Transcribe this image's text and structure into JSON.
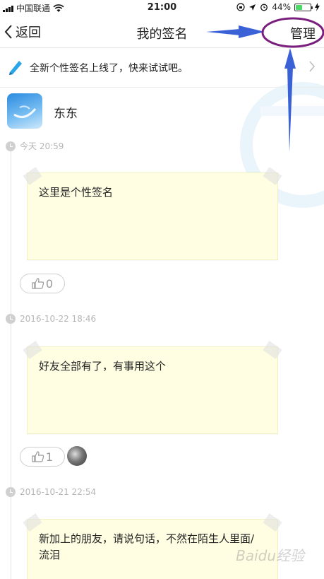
{
  "status_bar": {
    "carrier": "中国联通",
    "time": "21:00",
    "battery": "44%",
    "battery_level": 0.44
  },
  "nav": {
    "back_label": "返回",
    "title": "我的签名",
    "manage_label": "管理"
  },
  "banner": {
    "text": "全新个性签名上线了，快来试试吧。"
  },
  "profile": {
    "name": "东东"
  },
  "entries": [
    {
      "time": "今天 20:59",
      "text": "这里是个性签名",
      "likes": "0"
    },
    {
      "time": "2016-10-22 18:46",
      "text": "好友全部有了，有事用这个",
      "likes": "1"
    },
    {
      "time": "2016-10-21 22:54",
      "text": "新加上的朋友，请说句话，不然在陌生人里面/流泪"
    }
  ],
  "watermark": "Baidu经验",
  "colors": {
    "note_bg": "#fffde2",
    "annotation_arrow": "#3a62d6",
    "annotation_circle": "#7b1f7e"
  }
}
